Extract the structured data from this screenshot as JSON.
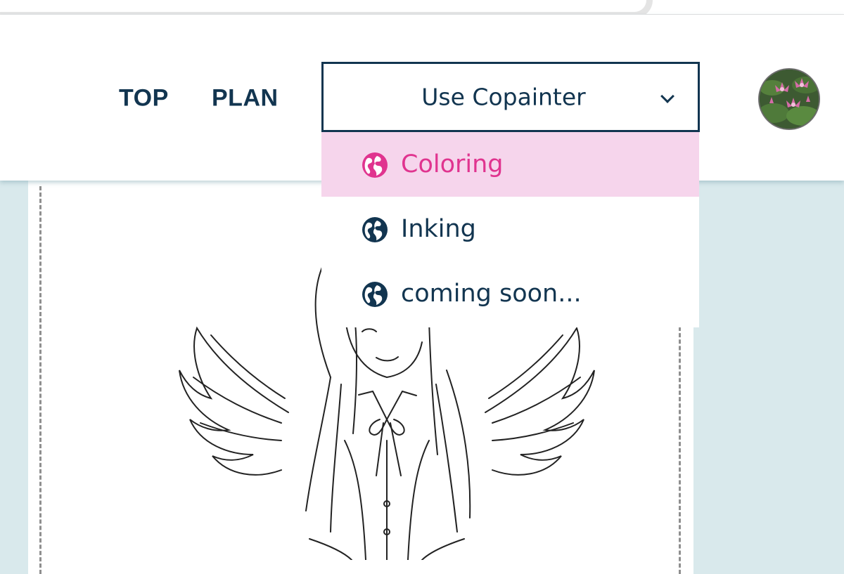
{
  "nav": {
    "top_label": "TOP",
    "plan_label": "PLAN"
  },
  "dropdown": {
    "label": "Use Copainter",
    "items": [
      {
        "label": "Coloring",
        "icon": "globe-icon",
        "active": true
      },
      {
        "label": "Inking",
        "icon": "globe-icon",
        "active": false
      },
      {
        "label": "coming soon...",
        "icon": "globe-icon",
        "active": false
      }
    ]
  },
  "colors": {
    "navy": "#123550",
    "accent_pink": "#e0348f",
    "active_bg": "#f6d5ec",
    "page_bg": "#d9e9ec"
  }
}
